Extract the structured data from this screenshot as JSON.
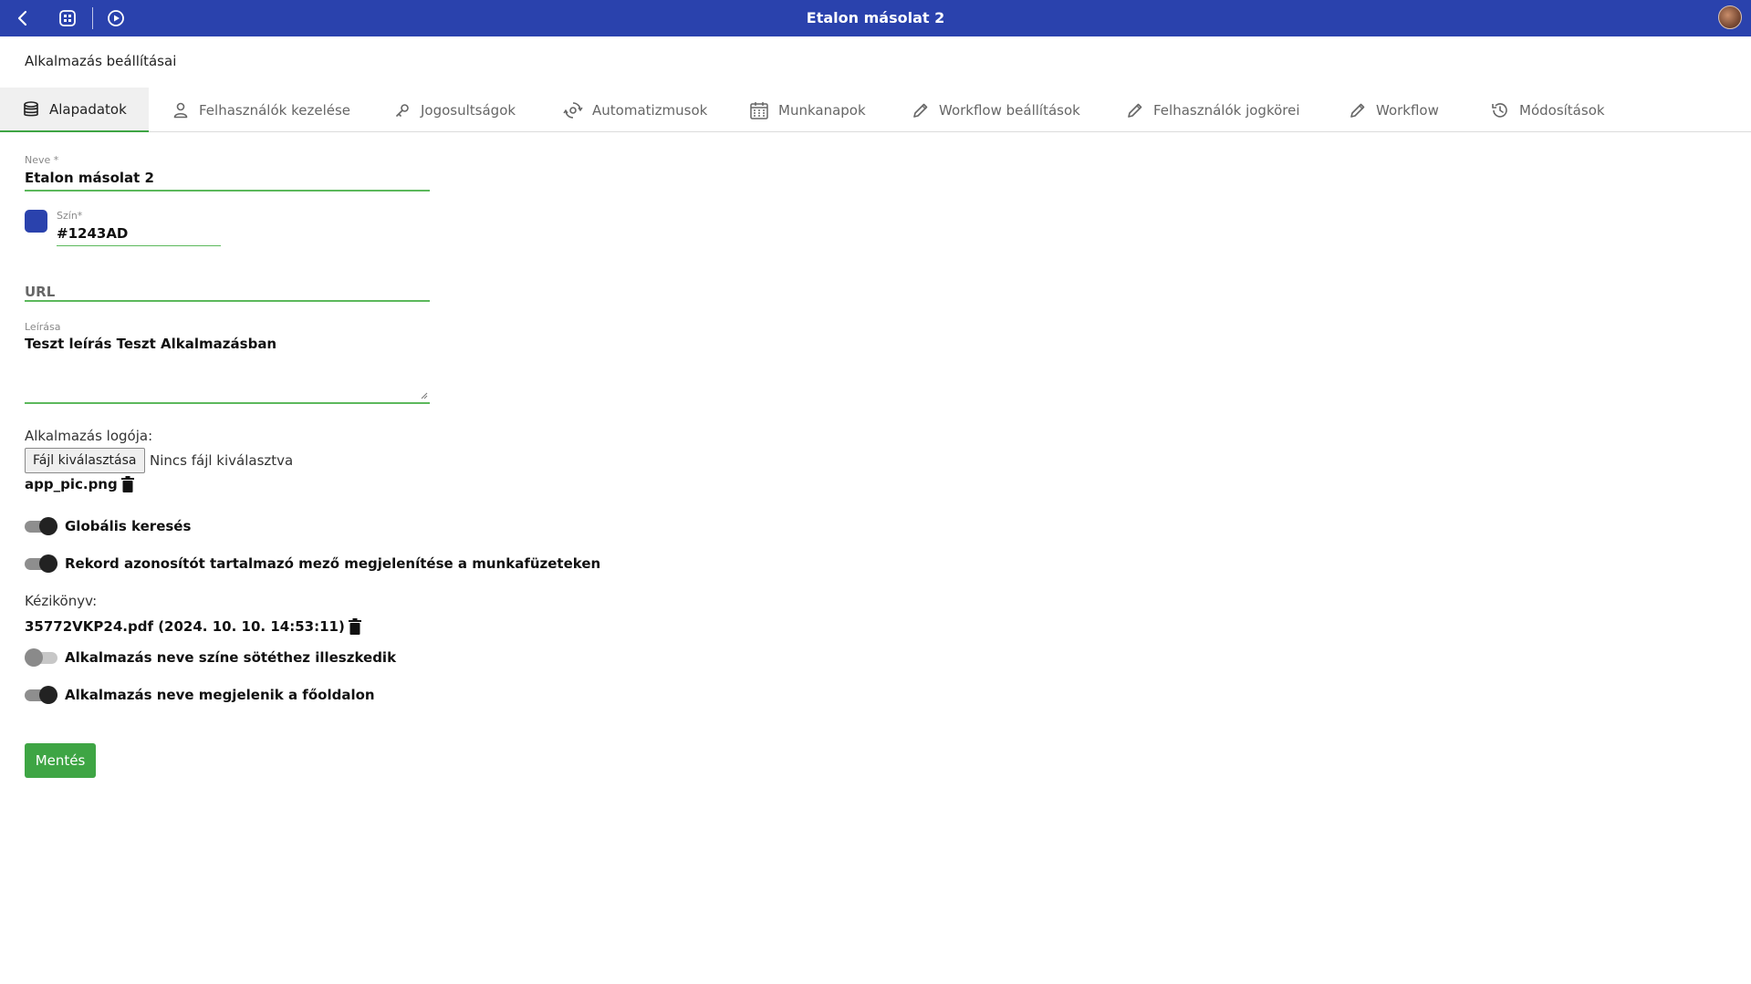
{
  "window": {
    "title": "Etalon másolat 2"
  },
  "icons": {
    "back": "chevron-left-icon",
    "apps": "apps-grid-icon",
    "play": "play-circle-icon",
    "avatar": "user-avatar"
  },
  "colors": {
    "brand": "#2a42ad",
    "accent": "#3ea544",
    "swatch": "#1243AD"
  },
  "page": {
    "heading": "Alkalmazás beállításai"
  },
  "tabs": [
    {
      "label": "Alapadatok",
      "icon": "database-icon",
      "active": true
    },
    {
      "label": "Felhasználók kezelése",
      "icon": "user-icon",
      "active": false
    },
    {
      "label": "Jogosultságok",
      "icon": "key-icon",
      "active": false
    },
    {
      "label": "Automatizmusok",
      "icon": "gear-cycle-icon",
      "active": false
    },
    {
      "label": "Munkanapok",
      "icon": "calendar-icon",
      "active": false
    },
    {
      "label": "Workflow beállítások",
      "icon": "pencil-icon",
      "active": false
    },
    {
      "label": "Felhasználók jogkörei",
      "icon": "pencil-icon",
      "active": false
    },
    {
      "label": "Workflow",
      "icon": "pencil-icon",
      "active": false
    },
    {
      "label": "Módosítások",
      "icon": "history-icon",
      "active": false
    }
  ],
  "form": {
    "name": {
      "label": "Neve *",
      "value": "Etalon másolat 2"
    },
    "color": {
      "label": "Szín*",
      "value": "#1243AD"
    },
    "url": {
      "placeholder": "URL",
      "value": ""
    },
    "description": {
      "label": "Leírása",
      "value": "Teszt leírás Teszt Alkalmazásban"
    },
    "logo": {
      "label": "Alkalmazás logója:",
      "button": "Fájl kiválasztása",
      "no_file": "Nincs fájl kiválasztva",
      "current_file": "app_pic.png"
    },
    "toggles": [
      {
        "label": "Globális keresés",
        "on": true
      },
      {
        "label": "Rekord azonosítót tartalmazó mező megjelenítése a munkafüzeteken",
        "on": true
      }
    ],
    "manual": {
      "label": "Kézikönyv:",
      "file": "35772VKP24.pdf (2024. 10. 10. 14:53:11)"
    },
    "toggles2": [
      {
        "label": "Alkalmazás neve színe sötéthez illeszkedik",
        "on": false
      },
      {
        "label": "Alkalmazás neve megjelenik a főoldalon",
        "on": true
      }
    ],
    "save": "Mentés"
  }
}
